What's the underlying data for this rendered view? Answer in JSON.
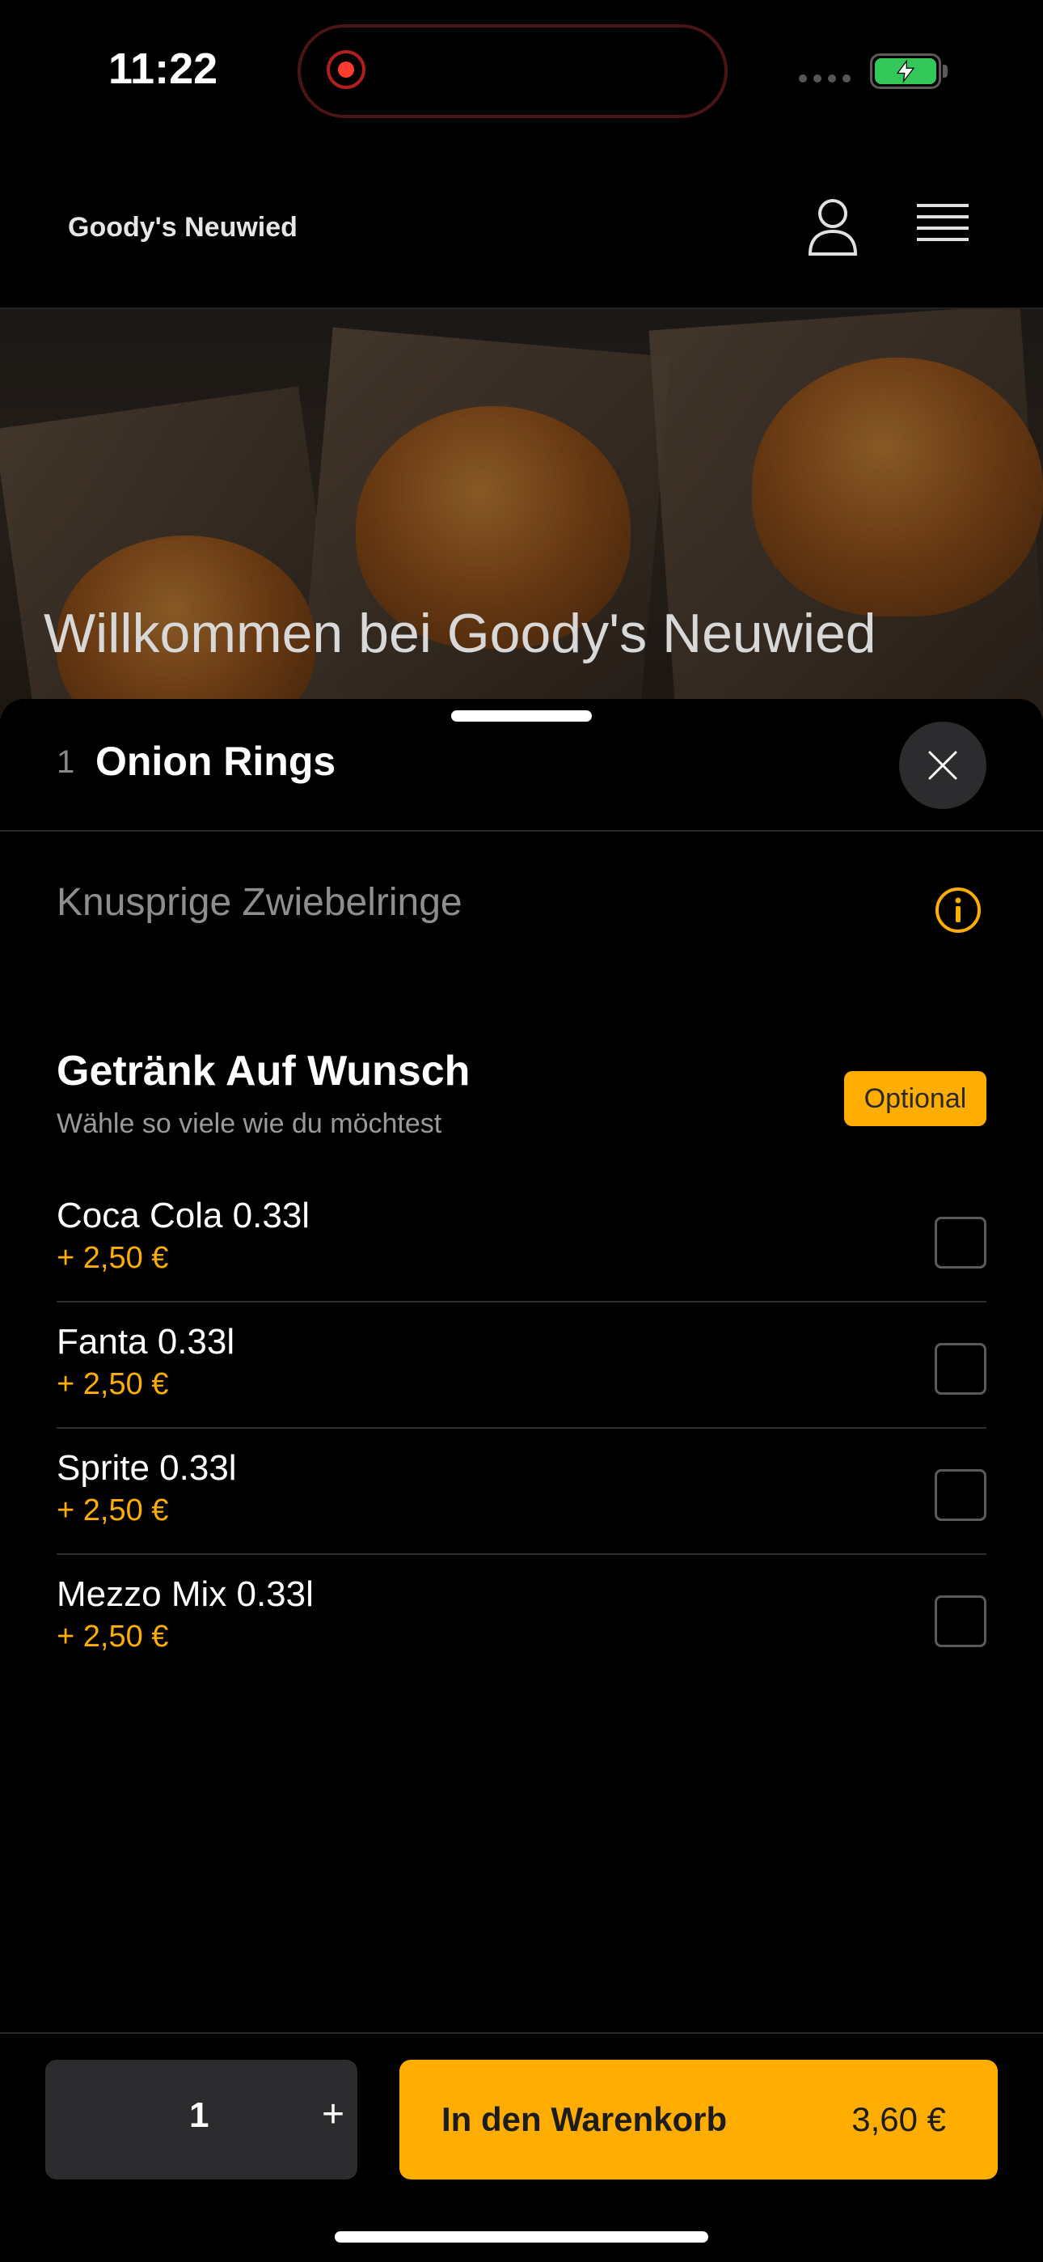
{
  "status_bar": {
    "time": "11:22",
    "battery_color": "#34c759",
    "record_color": "#ff3b30"
  },
  "header": {
    "brand": "Goody's Neuwied"
  },
  "hero": {
    "title": "Willkommen bei Goody's Neuwied"
  },
  "product": {
    "quantity_badge": "1",
    "title": "Onion Rings",
    "description": "Knusprige Zwiebelringe"
  },
  "options_group": {
    "title": "Getränk Auf Wunsch",
    "subtitle": "Wähle so viele wie du möchtest",
    "badge": "Optional",
    "items": [
      {
        "name": "Coca Cola 0.33l",
        "price": "+ 2,50 €",
        "checked": false
      },
      {
        "name": "Fanta 0.33l",
        "price": "+ 2,50 €",
        "checked": false
      },
      {
        "name": "Sprite 0.33l",
        "price": "+ 2,50 €",
        "checked": false
      },
      {
        "name": "Mezzo Mix 0.33l",
        "price": "+ 2,50 €",
        "checked": false
      }
    ]
  },
  "footer": {
    "quantity": "1",
    "plus_label": "+",
    "add_to_cart_label": "In den Warenkorb",
    "total": "3,60 €"
  },
  "colors": {
    "accent": "#ffad00",
    "background": "#000000"
  }
}
